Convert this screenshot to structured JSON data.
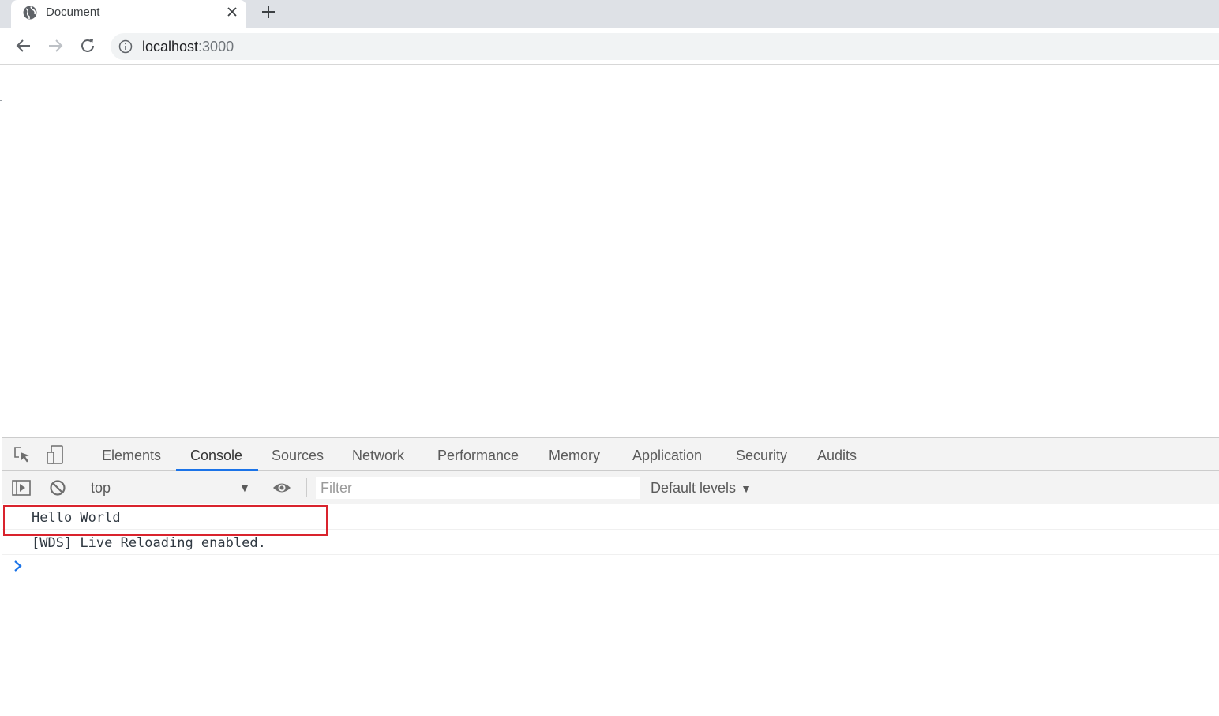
{
  "browser": {
    "tab": {
      "title": "Document",
      "favicon": "globe-icon",
      "close_icon": "close-icon"
    },
    "new_tab_icon": "plus-icon",
    "toolbar": {
      "back_icon": "arrow-left-icon",
      "forward_icon": "arrow-right-icon",
      "reload_icon": "reload-icon",
      "info_icon": "info-icon",
      "url_host": "localhost",
      "url_port": ":3000"
    }
  },
  "devtools": {
    "tabs": [
      {
        "label": "Elements",
        "active": false
      },
      {
        "label": "Console",
        "active": true
      },
      {
        "label": "Sources",
        "active": false
      },
      {
        "label": "Network",
        "active": false
      },
      {
        "label": "Performance",
        "active": false
      },
      {
        "label": "Memory",
        "active": false
      },
      {
        "label": "Application",
        "active": false
      },
      {
        "label": "Security",
        "active": false
      },
      {
        "label": "Audits",
        "active": false
      }
    ],
    "console_toolbar": {
      "context": "top",
      "filter_placeholder": "Filter",
      "levels": "Default levels"
    },
    "messages": [
      {
        "text": "Hello World",
        "highlighted": true
      },
      {
        "text": "[WDS] Live Reloading enabled.",
        "highlighted": false
      }
    ],
    "colors": {
      "accent": "#1a73e8",
      "highlight_border": "#d9232d"
    }
  }
}
